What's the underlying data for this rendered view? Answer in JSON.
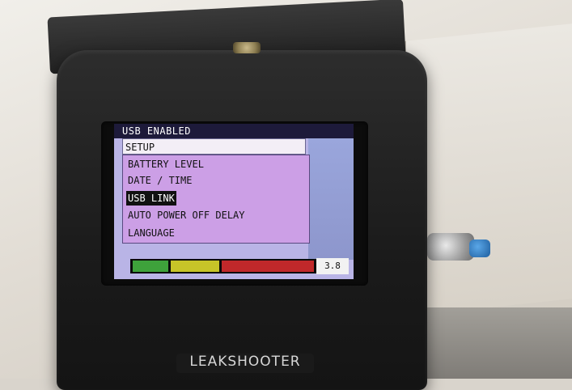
{
  "screen": {
    "status_title": "USB ENABLED",
    "menu_header": "SETUP",
    "menu_items": [
      {
        "label": "BATTERY LEVEL",
        "selected": false
      },
      {
        "label": "DATE / TIME",
        "selected": false
      },
      {
        "label": "USB LINK",
        "selected": true
      },
      {
        "label": "AUTO POWER OFF DELAY",
        "selected": false
      },
      {
        "label": "LANGUAGE",
        "selected": false
      }
    ],
    "battery": {
      "value_text": "3.8",
      "segments": [
        {
          "name": "green",
          "color": "#3ea23b"
        },
        {
          "name": "yellow",
          "color": "#c7c428"
        },
        {
          "name": "red",
          "color": "#c0282a"
        }
      ]
    }
  },
  "device": {
    "brand": "LEAKSHOOTER"
  }
}
